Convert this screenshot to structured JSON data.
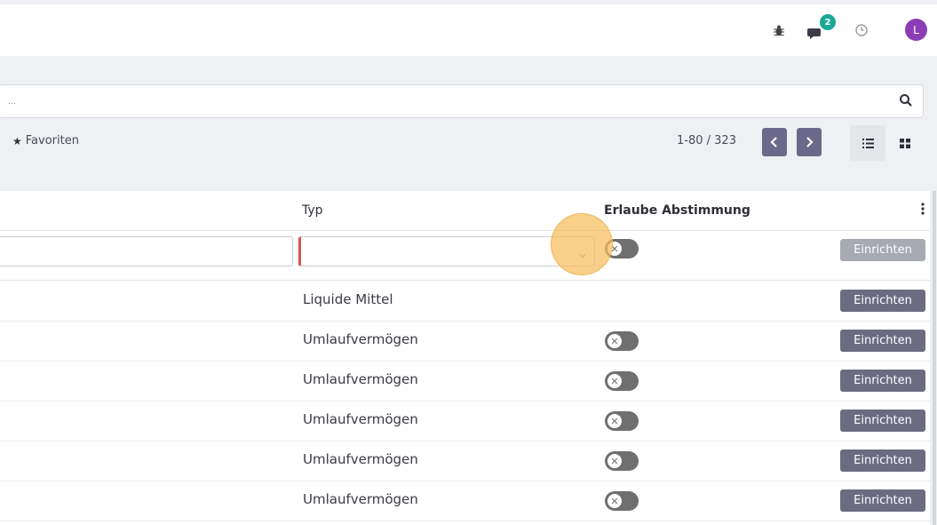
{
  "navbar": {
    "chat_badge": "2",
    "avatar_initial": "L",
    "icons": [
      "bug-icon",
      "chat-icon",
      "clock-icon"
    ]
  },
  "control_panel": {
    "search_placeholder": "...",
    "favorites_label": "Favoriten",
    "pager_value": "1-80 / 323"
  },
  "table": {
    "columns": {
      "typ": "Typ",
      "erlaube": "Erlaube Abstimmung"
    },
    "edit_row": {
      "action_label": "Einrichten"
    },
    "rows": [
      {
        "typ": "Liquide Mittel",
        "action": "Einrichten"
      },
      {
        "typ": "Umlaufvermögen",
        "action": "Einrichten"
      },
      {
        "typ": "Umlaufvermögen",
        "action": "Einrichten"
      },
      {
        "typ": "Umlaufvermögen",
        "action": "Einrichten"
      },
      {
        "typ": "Umlaufvermögen",
        "action": "Einrichten"
      },
      {
        "typ": "Umlaufvermögen",
        "action": "Einrichten"
      }
    ]
  },
  "colors": {
    "accent": "#6c6889",
    "badge": "#1aa894",
    "avatar": "#8b3db3",
    "required_border": "#d9534f",
    "toggle_off": "#6f6f6f"
  }
}
